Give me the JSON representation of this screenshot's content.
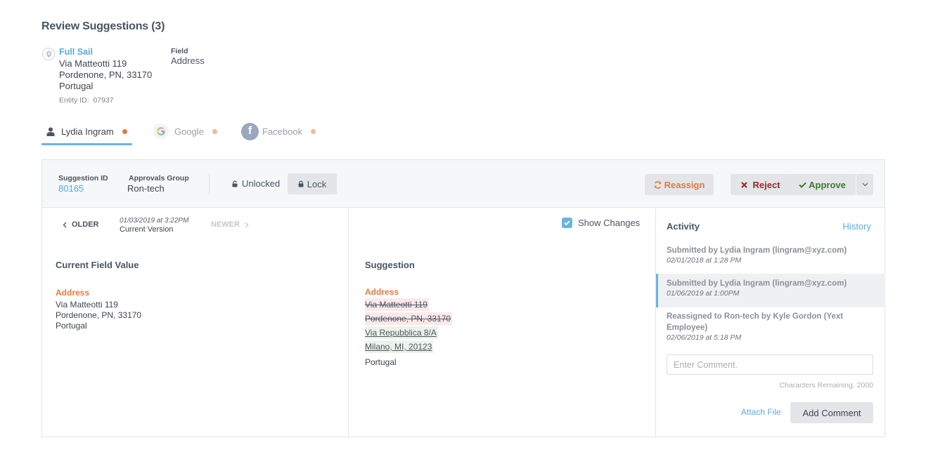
{
  "page": {
    "title": "Review Suggestions (3)"
  },
  "entity": {
    "name": "Full Sail",
    "address_lines": [
      "Via Matteotti 119",
      "Pordenone, PN, 33170",
      "Portugal"
    ],
    "entity_id_label": "Entity ID:",
    "entity_id": "07937",
    "field_label": "Field",
    "field_value": "Address",
    "icon": "location-pin-icon"
  },
  "tabs": [
    {
      "label": "Lydia Ingram",
      "icon": "user-icon",
      "active": true,
      "dot_color": "#e07b3f"
    },
    {
      "label": "Google",
      "icon": "google-icon",
      "active": false,
      "dot_color": "#f0b999"
    },
    {
      "label": "Facebook",
      "icon": "facebook-icon",
      "active": false,
      "dot_color": "#f0b999"
    }
  ],
  "header": {
    "suggestion_id_label": "Suggestion ID",
    "suggestion_id": "80165",
    "approvals_group_label": "Approvals Group",
    "approvals_group": "Ron-tech",
    "lock_status": "Unlocked",
    "lock_button": "Lock",
    "reassign_button": "Reassign",
    "reject_button": "Reject",
    "approve_button": "Approve"
  },
  "version_nav": {
    "older_label": "OLDER",
    "date": "01/03/2019 at 3:22PM",
    "version_label": "Current Version",
    "newer_label": "NEWER"
  },
  "current": {
    "title": "Current Field Value",
    "field_label": "Address",
    "lines": [
      "Via Matteotti 119",
      "Pordenone, PN, 33170",
      "Portugal"
    ]
  },
  "suggestion": {
    "show_changes_label": "Show Changes",
    "show_changes_checked": true,
    "title": "Suggestion",
    "field_label": "Address",
    "lines": [
      {
        "text": "Via Matteotti 119",
        "change": "removed"
      },
      {
        "text": "Pordenone, PN, 33170",
        "change": "removed"
      },
      {
        "text": "Via Repubblica 8/A",
        "change": "added"
      },
      {
        "text": "Milano, MI, 20123",
        "change": "added"
      },
      {
        "text": "Portugal",
        "change": "none"
      }
    ]
  },
  "activity": {
    "title": "Activity",
    "history_link": "History",
    "items": [
      {
        "text": "Submitted by Lydia Ingram (lingram@xyz.com)",
        "date": "02/01/2018 at 1:28 PM",
        "selected": false
      },
      {
        "text": "Submitted by Lydia Ingram (lingram@xyz.com)",
        "date": "01/06/2019 at 1:00PM",
        "selected": true
      },
      {
        "text": "Reassigned to Ron-tech by Kyle Gordon (Yext Employee)",
        "date": "02/06/2019 at 5:18 PM",
        "selected": false
      }
    ],
    "comment_placeholder": "Enter Comment.",
    "comment_value": "",
    "chars_remaining": "Characters Remaining: 2000",
    "attach_file": "Attach File",
    "add_comment": "Add Comment"
  },
  "colors": {
    "accent": "#5aa9df",
    "field_label": "#e07b3f",
    "reject": "#a2262a",
    "approve": "#3f7a2f",
    "removed_bg": "#fbe9e9",
    "added_bg": "#edf3ea"
  }
}
